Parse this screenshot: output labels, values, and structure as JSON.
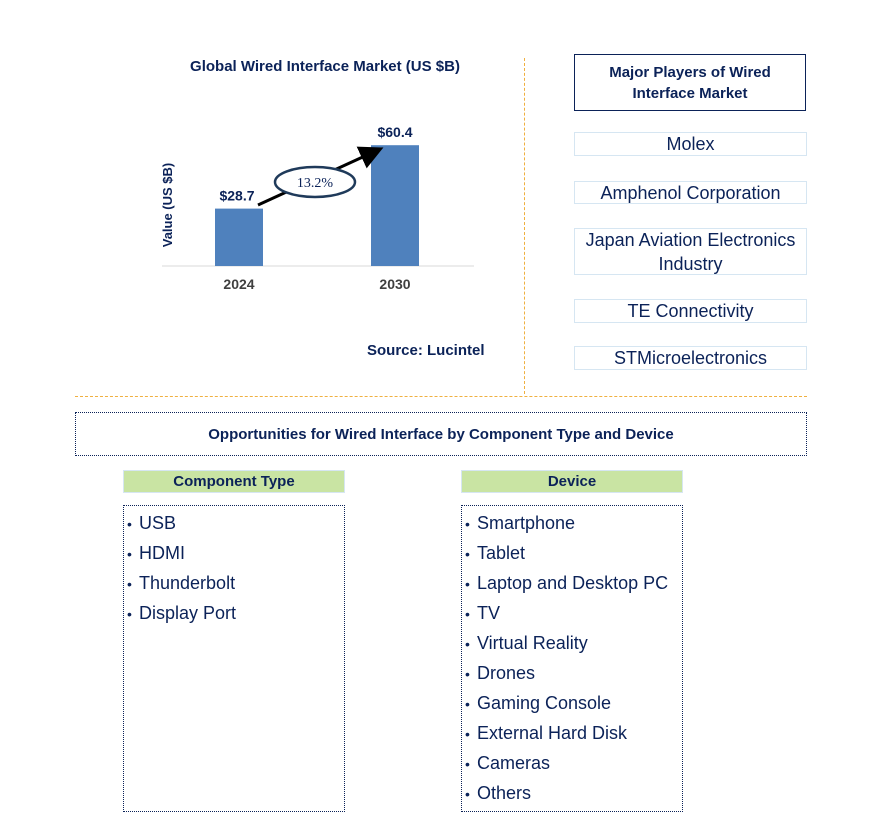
{
  "chart_data": {
    "type": "bar",
    "title": "Global Wired Interface Market (US $B)",
    "xlabel": "",
    "ylabel": "Value (US $B)",
    "categories": [
      "2024",
      "2030"
    ],
    "values": [
      28.7,
      60.4
    ],
    "data_labels": [
      "$28.7",
      "$60.4"
    ],
    "annotation": {
      "label": "13.2%",
      "meaning": "CAGR arrow from 2024 to 2030"
    },
    "ylim": [
      0,
      70
    ],
    "grid": false,
    "bar_color": "#4f81bd"
  },
  "source": "Source: Lucintel",
  "players": {
    "header": "Major Players of Wired Interface Market",
    "items": [
      "Molex",
      "Amphenol Corporation",
      "Japan Aviation Electronics Industry",
      "TE Connectivity",
      "STMicroelectronics"
    ]
  },
  "opportunities": {
    "header": "Opportunities for Wired Interface by Component Type and Device",
    "component_type": {
      "title": "Component Type",
      "items": [
        "USB",
        "HDMI",
        "Thunderbolt",
        "Display Port"
      ]
    },
    "device": {
      "title": "Device",
      "items": [
        "Smartphone",
        "Tablet",
        "Laptop and Desktop PC",
        "TV",
        "Virtual Reality",
        "Drones",
        "Gaming Console",
        "External Hard Disk",
        "Cameras",
        "Others"
      ]
    }
  },
  "colors": {
    "text": "#0b2258",
    "bar": "#4f81bd",
    "category_header_bg": "#c9e4a3",
    "divider": "#f0b040"
  }
}
